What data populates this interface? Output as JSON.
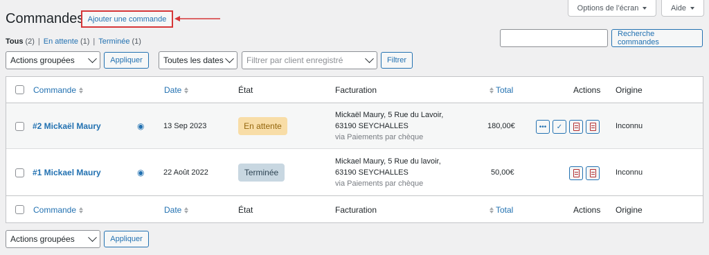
{
  "header": {
    "title": "Commandes",
    "add_button": "Ajouter une commande",
    "screen_options": "Options de l’écran",
    "help": "Aide"
  },
  "filters_nav": {
    "all": "Tous",
    "all_count": "(2)",
    "pending": "En attente",
    "pending_count": "(1)",
    "completed": "Terminée",
    "completed_count": "(1)"
  },
  "search": {
    "value": "",
    "button": "Recherche commandes"
  },
  "toolbar": {
    "bulk_actions": "Actions groupées",
    "apply": "Appliquer",
    "dates": "Toutes les dates",
    "customer_placeholder": "Filtrer par client enregistré",
    "filter": "Filtrer"
  },
  "table": {
    "columns": {
      "order": "Commande",
      "date": "Date",
      "status": "État",
      "billing": "Facturation",
      "total": "Total",
      "actions": "Actions",
      "origin": "Origine"
    },
    "rows": [
      {
        "order": "#2 Mickaël Maury",
        "date": "13 Sep 2023",
        "status": "En attente",
        "billing_line1": "Mickaël Maury, 5 Rue du Lavoir,",
        "billing_line2": "63190 SEYCHALLES",
        "billing_line3": "via Paiements par chèque",
        "total": "180,00€",
        "origin": "Inconnu"
      },
      {
        "order": "#1 Mickael Maury",
        "date": "22 Août 2022",
        "status": "Terminée",
        "billing_line1": "Mickael Maury, 5 Rue du lavoir,",
        "billing_line2": "63190 SEYCHALLES",
        "billing_line3": "via Paiements par chèque",
        "total": "50,00€",
        "origin": "Inconnu"
      }
    ]
  },
  "bottom_toolbar": {
    "bulk_actions": "Actions groupées",
    "apply": "Appliquer"
  },
  "colors": {
    "accent": "#2271b1",
    "pending_bg": "#f8dda7",
    "pending_fg": "#94660c",
    "completed_bg": "#c8d7e1",
    "completed_fg": "#2e4453",
    "highlight": "#d63638"
  }
}
